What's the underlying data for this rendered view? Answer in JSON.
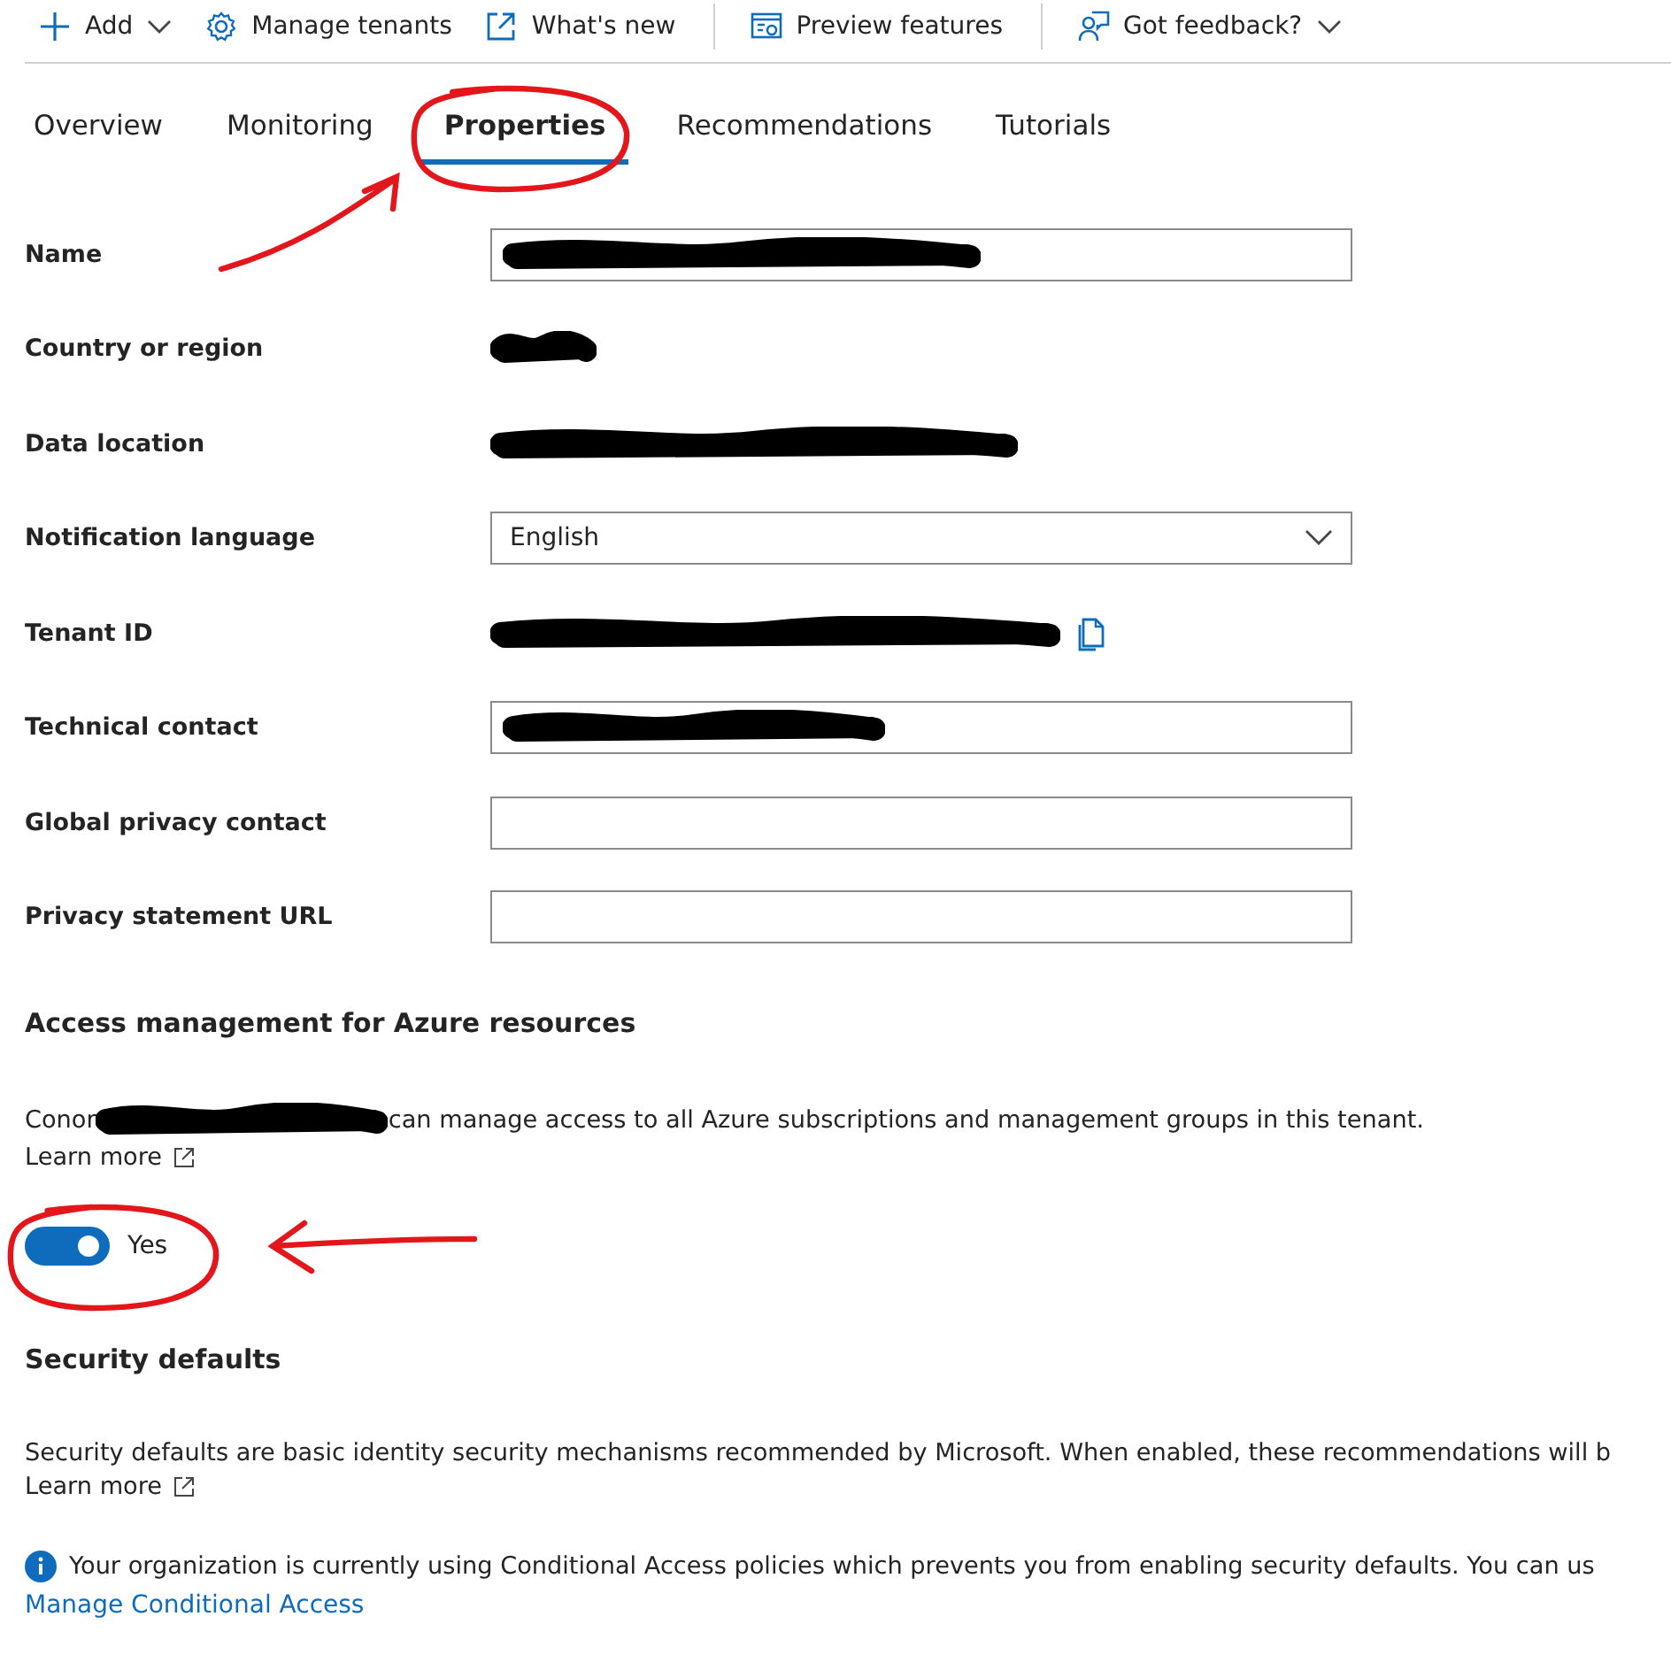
{
  "toolbar": [
    {
      "label": "Add"
    },
    {
      "label": "Manage tenants"
    },
    {
      "label": "What's new"
    },
    {
      "label": "Preview features"
    },
    {
      "label": "Got feedback?"
    }
  ],
  "tabs": [
    {
      "label": "Overview",
      "selected": false
    },
    {
      "label": "Monitoring",
      "selected": false
    },
    {
      "label": "Properties",
      "selected": true
    },
    {
      "label": "Recommendations",
      "selected": false
    },
    {
      "label": "Tutorials",
      "selected": false
    }
  ],
  "properties": [
    {
      "label": "Name",
      "kind": "textbox",
      "redacted": true
    },
    {
      "label": "Country or region",
      "kind": "text",
      "redacted": true
    },
    {
      "label": "Data location",
      "kind": "text",
      "redacted": true
    },
    {
      "label": "Notification language",
      "kind": "dropdown",
      "value": "English"
    },
    {
      "label": "Tenant ID",
      "kind": "copytext",
      "redacted": true
    },
    {
      "label": "Technical contact",
      "kind": "textbox",
      "redacted": true
    },
    {
      "label": "Global privacy contact",
      "kind": "textbox",
      "redacted": false
    },
    {
      "label": "Privacy statement URL",
      "kind": "textbox",
      "redacted": false
    }
  ],
  "access_management": {
    "heading": "Access management for Azure resources",
    "owner_prefix": "Conor",
    "owner_redacted": true,
    "text": "can manage access to all Azure subscriptions and management groups in this tenant.",
    "learn_more": "Learn more",
    "toggle": {
      "on": true,
      "label": "Yes"
    }
  },
  "security_defaults": {
    "heading": "Security defaults",
    "text": "Security defaults are basic identity security mechanisms recommended by Microsoft. When enabled, these recommendations will b",
    "learn_more": "Learn more",
    "info": "Your organization is currently using Conditional Access policies which prevents you from enabling security defaults. You can us",
    "link": "Manage Conditional Access"
  },
  "annotations": [
    {
      "kind": "circle"
    },
    {
      "kind": "arrow"
    },
    {
      "kind": "circle"
    },
    {
      "kind": "arrow"
    }
  ]
}
